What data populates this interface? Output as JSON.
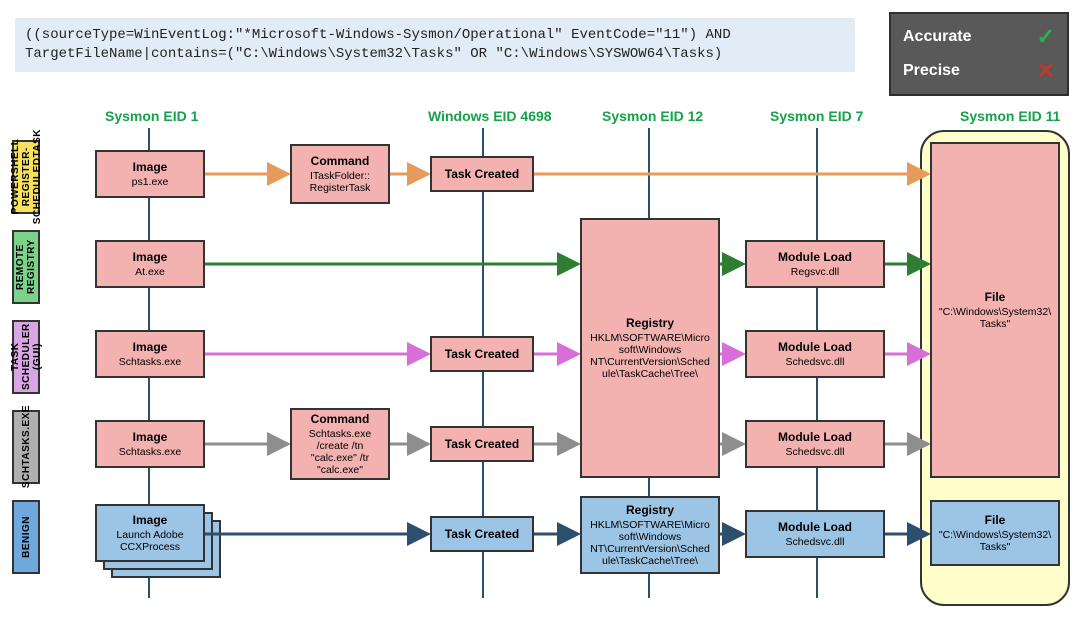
{
  "query": "((sourceType=WinEventLog:\"*Microsoft-Windows-Sysmon/Operational\" EventCode=\"11\") AND TargetFileName|contains=(\"C:\\Windows\\System32\\Tasks\" OR \"C:\\Windows\\SYSWOW64\\Tasks)",
  "legend": {
    "accurate": "Accurate",
    "precise": "Precise"
  },
  "columns": {
    "c1": "Sysmon EID 1",
    "c2": "Windows EID 4698",
    "c3": "Sysmon EID 12",
    "c4": "Sysmon EID 7",
    "c5": "Sysmon EID 11"
  },
  "rows": {
    "r1": "POWERSHELL REGISTER-SCHEDULEDTASK",
    "r2": "REMOTE REGISTRY",
    "r3": "TASK SCHEDULER (GUI)",
    "r4": "SCHTASKS.EXE",
    "r5": "BENIGN"
  },
  "row_colors": {
    "r1": "#f6e05e",
    "r2": "#7bd389",
    "r3": "#d8a6e3",
    "r4": "#b0b0b0",
    "r5": "#6fa8dc"
  },
  "nodes": {
    "r1_img": {
      "t": "Image",
      "s": "ps1.exe"
    },
    "r1_cmd": {
      "t": "Command",
      "s": "ITaskFolder::\nRegisterTask"
    },
    "r1_task": {
      "t": "Task Created",
      "s": ""
    },
    "r2_img": {
      "t": "Image",
      "s": "At.exe"
    },
    "r2_mod": {
      "t": "Module Load",
      "s": "Regsvc.dll"
    },
    "r3_img": {
      "t": "Image",
      "s": "Schtasks.exe"
    },
    "r3_task": {
      "t": "Task Created",
      "s": ""
    },
    "r3_mod": {
      "t": "Module Load",
      "s": "Schedsvc.dll"
    },
    "r4_img": {
      "t": "Image",
      "s": "Schtasks.exe"
    },
    "r4_cmd": {
      "t": "Command",
      "s": "Schtasks.exe /create /tn \"calc.exe\" /tr \"calc.exe\""
    },
    "r4_task": {
      "t": "Task Created",
      "s": ""
    },
    "r4_mod": {
      "t": "Module Load",
      "s": "Schedsvc.dll"
    },
    "r5_img": {
      "t": "Image",
      "s": "Launch Adobe CCXProcess"
    },
    "r5_task": {
      "t": "Task Created",
      "s": ""
    },
    "r5_reg": {
      "t": "Registry",
      "s": "HKLM\\SOFTWARE\\Microsoft\\Windows NT\\CurrentVersion\\Schedule\\TaskCache\\Tree\\"
    },
    "r5_mod": {
      "t": "Module Load",
      "s": "Schedsvc.dll"
    },
    "r5_file": {
      "t": "File",
      "s": "\"C:\\Windows\\System32\\Tasks\""
    },
    "reg_big": {
      "t": "Registry",
      "s": "HKLM\\SOFTWARE\\Microsoft\\Windows NT\\CurrentVersion\\Schedule\\TaskCache\\Tree\\"
    },
    "file_big": {
      "t": "File",
      "s": "\"C:\\Windows\\System32\\Tasks\""
    }
  },
  "arrow_colors": {
    "r1": "#e69b5a",
    "r2": "#2e7d32",
    "r3": "#d86fd8",
    "r4": "#8e8e8e",
    "r5": "#2c4f6e"
  }
}
